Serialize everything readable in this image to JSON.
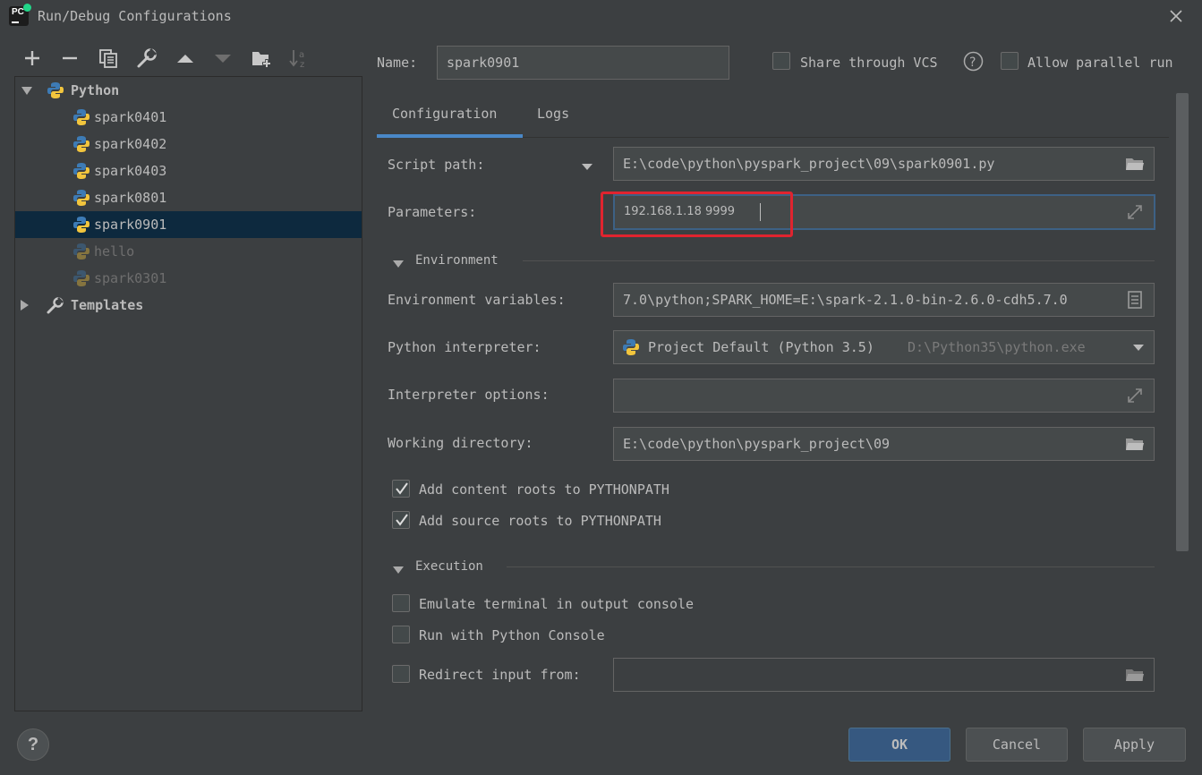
{
  "window": {
    "title": "Run/Debug Configurations"
  },
  "toolbar": {
    "items": [
      "add-icon",
      "remove-icon",
      "copy-icon",
      "wrench-icon",
      "move-up-icon",
      "move-down-icon",
      "new-folder-icon",
      "sort-icon"
    ]
  },
  "tree": {
    "root_label": "Python",
    "items": [
      {
        "label": "spark0401",
        "selected": false,
        "temporary": false
      },
      {
        "label": "spark0402",
        "selected": false,
        "temporary": false
      },
      {
        "label": "spark0403",
        "selected": false,
        "temporary": false
      },
      {
        "label": "spark0801",
        "selected": false,
        "temporary": false
      },
      {
        "label": "spark0901",
        "selected": true,
        "temporary": false
      },
      {
        "label": "hello",
        "selected": false,
        "temporary": true
      },
      {
        "label": "spark0301",
        "selected": false,
        "temporary": true
      }
    ],
    "templates_label": "Templates"
  },
  "header": {
    "name_label": "Name:",
    "name_value": "spark0901",
    "share_vcs_label": "Share through VCS",
    "share_vcs_checked": false,
    "allow_parallel_label": "Allow parallel run",
    "allow_parallel_checked": false
  },
  "tabs": [
    {
      "label": "Configuration",
      "active": true
    },
    {
      "label": "Logs",
      "active": false
    }
  ],
  "config": {
    "script_path_label": "Script path:",
    "script_path_value": "E:\\code\\python\\pyspark_project\\09\\spark0901.py",
    "parameters_label": "Parameters:",
    "parameters_value": "192.168.1.18 9999",
    "environment_section": "Environment",
    "env_vars_label": "Environment variables:",
    "env_vars_value": "7.0\\python;SPARK_HOME=E:\\spark-2.1.0-bin-2.6.0-cdh5.7.0",
    "interpreter_label": "Python interpreter:",
    "interpreter_value": "Project Default (Python 3.5)",
    "interpreter_path": "D:\\Python35\\python.exe",
    "interp_options_label": "Interpreter options:",
    "interp_options_value": "",
    "working_dir_label": "Working directory:",
    "working_dir_value": "E:\\code\\python\\pyspark_project\\09",
    "add_content_roots_label": "Add content roots to PYTHONPATH",
    "add_content_roots_checked": true,
    "add_source_roots_label": "Add source roots to PYTHONPATH",
    "add_source_roots_checked": true,
    "execution_section": "Execution",
    "emulate_terminal_label": "Emulate terminal in output console",
    "emulate_terminal_checked": false,
    "python_console_label": "Run with Python Console",
    "python_console_checked": false,
    "redirect_input_label": "Redirect input from:",
    "redirect_input_checked": false,
    "redirect_input_value": ""
  },
  "footer": {
    "help_label": "?",
    "ok_label": "OK",
    "cancel_label": "Cancel",
    "apply_label": "Apply"
  },
  "colors": {
    "background": "#3c3f41",
    "field": "#45494a",
    "selection": "#0d293e",
    "accent": "#4a88c7",
    "highlight_box": "#e0242f"
  }
}
